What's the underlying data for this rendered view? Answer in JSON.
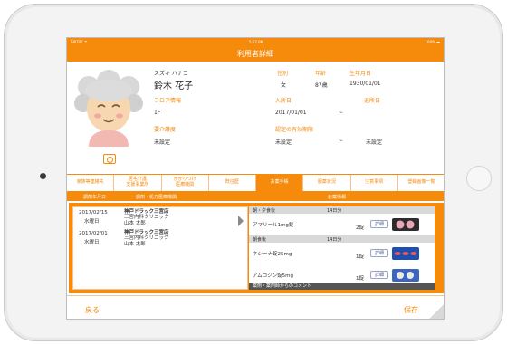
{
  "status": {
    "carrier": "Carrier ᯤ",
    "time": "5:57 PM",
    "battery": "100% ▬"
  },
  "title": "利用者詳細",
  "profile": {
    "kana": "スズキ ハナコ",
    "name": "鈴木 花子",
    "gender_label": "性別",
    "gender": "女",
    "age_label": "年齢",
    "age": "87歳",
    "dob_label": "生年月日",
    "dob": "1930/01/01",
    "floor_label": "フロア情報",
    "floor": "1F",
    "admission_label": "入所日",
    "admission": "2017/01/01",
    "admission_sep": "~",
    "discharge_label": "退所日",
    "care_label": "要介護度",
    "care": "未設定",
    "cert_label": "認定の有効期限",
    "cert_from": "未設定",
    "cert_sep": "~",
    "cert_to": "未設定"
  },
  "tabs": [
    {
      "label": "家族等連絡先"
    },
    {
      "label": "居宅介護\n支援事業所"
    },
    {
      "label": "かかりつけ\n医療機関"
    },
    {
      "label": "既往歴"
    },
    {
      "label": "お薬手帳",
      "active": true
    },
    {
      "label": "服薬状況"
    },
    {
      "label": "注意事項"
    },
    {
      "label": "登録画像一覧"
    }
  ],
  "subheader": {
    "col1": "調剤年月日",
    "col2": "調剤・処方医療機関",
    "col3": "お薬情報"
  },
  "dispense": [
    {
      "date": "2017/02/15",
      "weekday": "水曜日",
      "pharmacy": "神戸ドラック三宮店",
      "clinic": "三宮内科クリニック",
      "doctor": "山本 太郎"
    },
    {
      "date": "2017/02/01",
      "weekday": "水曜日",
      "pharmacy": "神戸ドラック三宮店",
      "clinic": "三宮内科クリニック",
      "doctor": "山本 太郎"
    }
  ],
  "medicines": [
    {
      "timing": "朝・夕食後",
      "days": "14日分",
      "name": "アマリール1mg錠",
      "qty": "2錠",
      "detail": "詳細"
    },
    {
      "timing": "朝食後",
      "days": "14日分",
      "name": "ネシーナ錠25mg",
      "qty": "1錠",
      "detail": "詳細"
    },
    {
      "name": "アムロジン錠5mg",
      "qty": "1錠",
      "detail": "詳細"
    }
  ],
  "comment": "薬剤・薬剤師からのコメント",
  "footer": {
    "back": "戻る",
    "save": "保存"
  },
  "colors": {
    "accent": "#f58a0b"
  }
}
